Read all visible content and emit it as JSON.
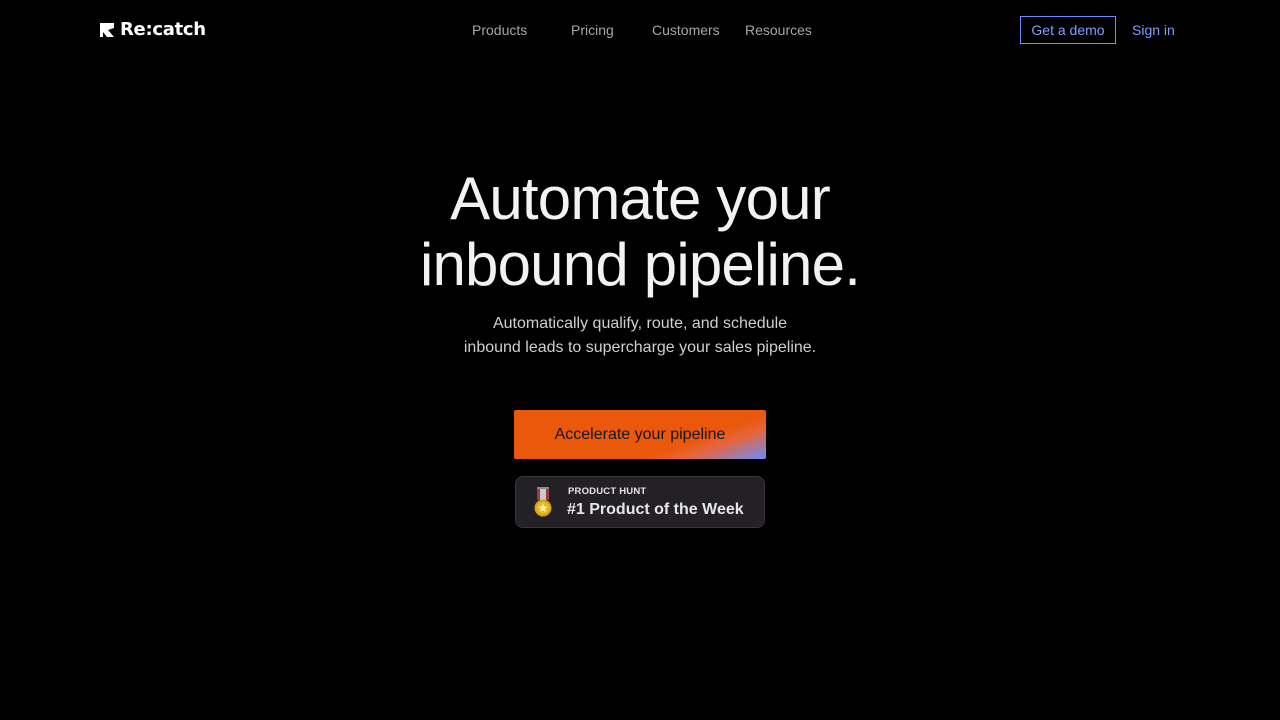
{
  "brand": {
    "name": "Re:catch"
  },
  "nav": {
    "items": [
      "Products",
      "Pricing",
      "Customers",
      "Resources"
    ]
  },
  "header": {
    "demo_label": "Get a demo",
    "signin_label": "Sign in"
  },
  "hero": {
    "headline_line1": "Automate your",
    "headline_line2": "inbound pipeline.",
    "subtitle_line1": "Automatically qualify, route, and schedule",
    "subtitle_line2": "inbound leads to supercharge your sales pipeline.",
    "cta_label": "Accelerate your pipeline"
  },
  "badge": {
    "label": "PRODUCT HUNT",
    "title": "#1 Product of the Week",
    "icon": "medal-icon"
  },
  "colors": {
    "background": "#000000",
    "accent": "#ea580c",
    "link": "#7f9dff"
  }
}
